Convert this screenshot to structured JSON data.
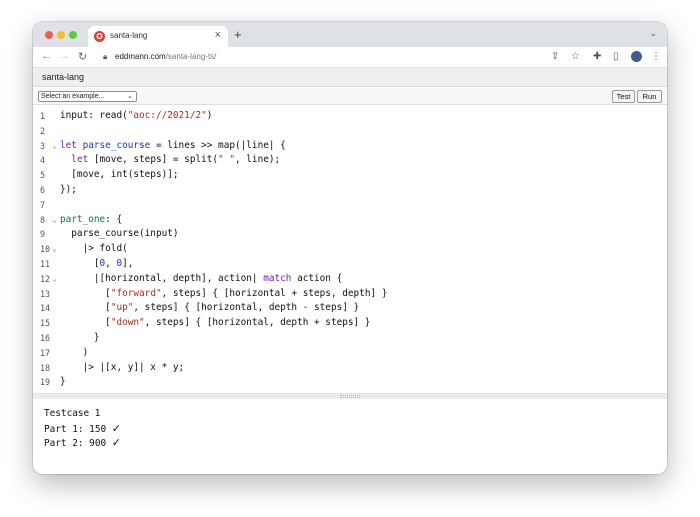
{
  "browser": {
    "tab_title": "santa-lang",
    "tab_close": "×",
    "new_tab": "+",
    "tabstrip_menu": "⌄",
    "url_domain": "eddmann.com",
    "url_path": "/santa-lang-ts/",
    "icons": [
      "back-icon",
      "forward-icon",
      "reload-icon",
      "lock-icon",
      "share-icon",
      "star-icon",
      "extensions-icon",
      "side-panel-icon",
      "profile-icon",
      "more-icon"
    ]
  },
  "app": {
    "title": "santa-lang",
    "example_select_value": "Select an example...",
    "test_label": "Test",
    "run_label": "Run"
  },
  "editor": {
    "lines": [
      {
        "num": "1",
        "fold": "",
        "code": "input: read(\"aoc://2021/2\")"
      },
      {
        "num": "2",
        "fold": "",
        "code": ""
      },
      {
        "num": "3",
        "fold": "⌄",
        "code": "let parse_course = lines >> map(|line| {"
      },
      {
        "num": "4",
        "fold": "",
        "code": "  let [move, steps] = split(\" \", line);"
      },
      {
        "num": "5",
        "fold": "",
        "code": "  [move, int(steps)];"
      },
      {
        "num": "6",
        "fold": "",
        "code": "});"
      },
      {
        "num": "7",
        "fold": "",
        "code": ""
      },
      {
        "num": "8",
        "fold": "⌄",
        "code": "part_one: {"
      },
      {
        "num": "9",
        "fold": "",
        "code": "  parse_course(input)"
      },
      {
        "num": "10",
        "fold": "⌄",
        "code": "    |> fold("
      },
      {
        "num": "11",
        "fold": "",
        "code": "      [0, 0],"
      },
      {
        "num": "12",
        "fold": "⌄",
        "code": "      |[horizontal, depth], action| match action {"
      },
      {
        "num": "13",
        "fold": "",
        "code": "        [\"forward\", steps] { [horizontal + steps, depth] }"
      },
      {
        "num": "14",
        "fold": "",
        "code": "        [\"up\", steps] { [horizontal, depth - steps] }"
      },
      {
        "num": "15",
        "fold": "",
        "code": "        [\"down\", steps] { [horizontal, depth + steps] }"
      },
      {
        "num": "16",
        "fold": "",
        "code": "      }"
      },
      {
        "num": "17",
        "fold": "",
        "code": "    )"
      },
      {
        "num": "18",
        "fold": "",
        "code": "    |> |[x, y]| x * y;"
      },
      {
        "num": "19",
        "fold": "",
        "code": "}"
      }
    ]
  },
  "output": {
    "testcase": "Testcase 1",
    "part1_label": "Part 1:",
    "part1_value": "150",
    "part2_label": "Part 2:",
    "part2_value": "900",
    "check": "✓"
  }
}
